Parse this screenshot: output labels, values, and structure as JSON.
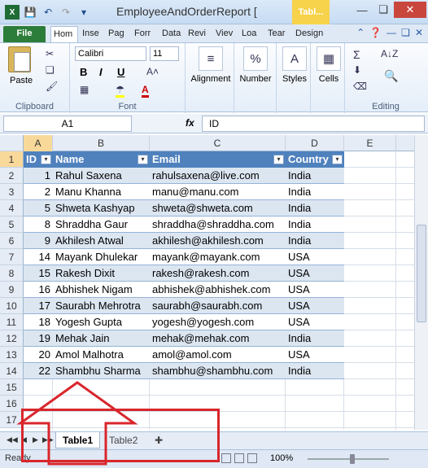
{
  "window": {
    "title": "EmployeeAndOrderReport  [",
    "table_tools": "Tabl...",
    "minimize_icon": "minimize-icon",
    "restore_icon": "restore-icon",
    "close_icon": "close-icon"
  },
  "ribbon_tabs": [
    "File",
    "Hom",
    "Inse",
    "Pag",
    "Forr",
    "Data",
    "Revi",
    "Viev",
    "Loa",
    "Tear",
    "Design"
  ],
  "ribbon": {
    "clipboard": {
      "paste": "Paste",
      "label": "Clipboard"
    },
    "font": {
      "name": "Calibri",
      "size": "11",
      "bold": "B",
      "italic": "I",
      "underline": "U",
      "label": "Font"
    },
    "alignment": "Alignment",
    "number": "Number",
    "styles": "Styles",
    "cells": "Cells",
    "editing": "Editing"
  },
  "formula_bar": {
    "name_box": "A1",
    "fx": "fx",
    "value": "ID"
  },
  "columns": [
    "A",
    "B",
    "C",
    "D",
    "E"
  ],
  "table": {
    "headers": [
      "ID",
      "Name",
      "Email",
      "Country"
    ],
    "rows": [
      [
        "1",
        "Rahul Saxena",
        "rahulsaxena@live.com",
        "India"
      ],
      [
        "2",
        "Manu Khanna",
        "manu@manu.com",
        "India"
      ],
      [
        "5",
        "Shweta Kashyap",
        "shweta@shweta.com",
        "India"
      ],
      [
        "8",
        "Shraddha Gaur",
        "shraddha@shraddha.com",
        "India"
      ],
      [
        "9",
        "Akhilesh Atwal",
        "akhilesh@akhilesh.com",
        "India"
      ],
      [
        "14",
        "Mayank Dhulekar",
        "mayank@mayank.com",
        "USA"
      ],
      [
        "15",
        "Rakesh Dixit",
        "rakesh@rakesh.com",
        "USA"
      ],
      [
        "16",
        "Abhishek Nigam",
        "abhishek@abhishek.com",
        "USA"
      ],
      [
        "17",
        "Saurabh Mehrotra",
        "saurabh@saurabh.com",
        "USA"
      ],
      [
        "18",
        "Yogesh Gupta",
        "yogesh@yogesh.com",
        "USA"
      ],
      [
        "19",
        "Mehak Jain",
        "mehak@mehak.com",
        "India"
      ],
      [
        "20",
        "Amol Malhotra",
        "amol@amol.com",
        "USA"
      ],
      [
        "22",
        "Shambhu Sharma",
        "shambhu@shambhu.com",
        "India"
      ]
    ]
  },
  "row_numbers": [
    "1",
    "2",
    "3",
    "4",
    "5",
    "6",
    "7",
    "8",
    "9",
    "10",
    "11",
    "12",
    "13",
    "14",
    "15",
    "16",
    "17"
  ],
  "sheets": [
    "Table1",
    "Table2"
  ],
  "status": {
    "ready": "Ready",
    "zoom": "100%"
  },
  "colors": {
    "table_header": "#4f81bd",
    "annotation": "#d8262c",
    "file_tab": "#2d7d3a"
  }
}
